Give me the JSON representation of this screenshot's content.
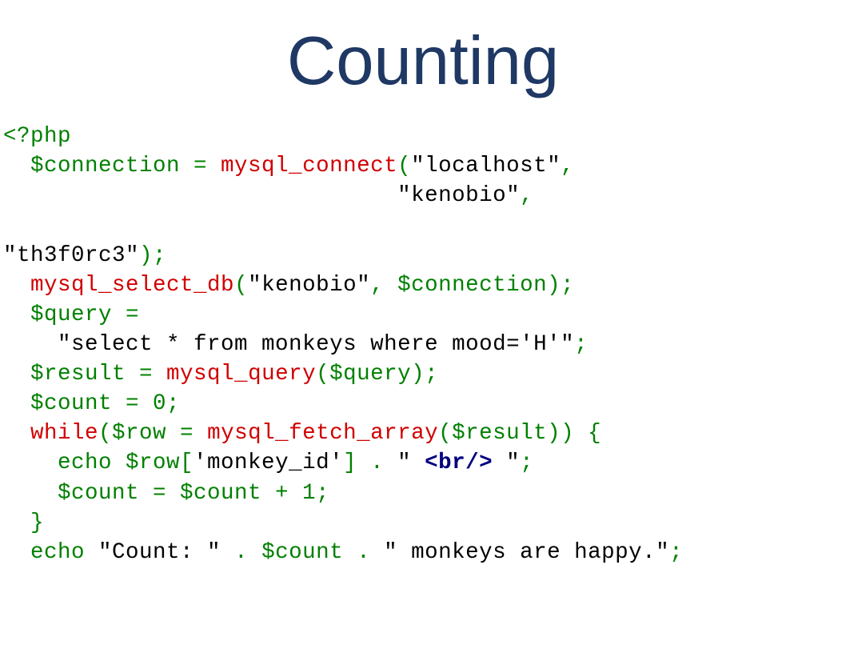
{
  "title": "Counting",
  "code": {
    "l1": {
      "a": "<?php"
    },
    "l2": {
      "a": "  $connection = ",
      "b": "mysql_connect",
      "c": "(",
      "d": "\"localhost\"",
      "e": ","
    },
    "l3": {
      "a": "                             ",
      "d": "\"kenobio\"",
      "e": ","
    },
    "l4": {
      "a": ""
    },
    "l5": {
      "d": "\"th3f0rc3\"",
      "e": ");"
    },
    "l6": {
      "a": "  ",
      "b": "mysql_select_db",
      "c": "(",
      "d": "\"kenobio\"",
      "e": ", $connection);"
    },
    "l7": {
      "a": "  $query ="
    },
    "l8": {
      "a": "    ",
      "d": "\"select * from monkeys where mood='H'\"",
      "e": ";"
    },
    "l9": {
      "a": "  $result = ",
      "b": "mysql_query",
      "c": "($query);"
    },
    "l10": {
      "a": "  $count = 0;"
    },
    "l11": {
      "a": "  ",
      "b": "while",
      "c": "($row = ",
      "d": "mysql_fetch_array",
      "e": "($result)) {"
    },
    "l12": {
      "a": "    echo $row[",
      "d": "'monkey_id'",
      "e": "] . ",
      "f": "\" ",
      "g": "<br/>",
      "h": " \"",
      "i": ";"
    },
    "l13": {
      "a": "    $count = $count + 1;"
    },
    "l14": {
      "a": "  }"
    },
    "l15": {
      "a": "  echo ",
      "d": "\"Count: \"",
      "e": " . $count . ",
      "f": "\" monkeys are happy.\"",
      "g": ";"
    }
  }
}
